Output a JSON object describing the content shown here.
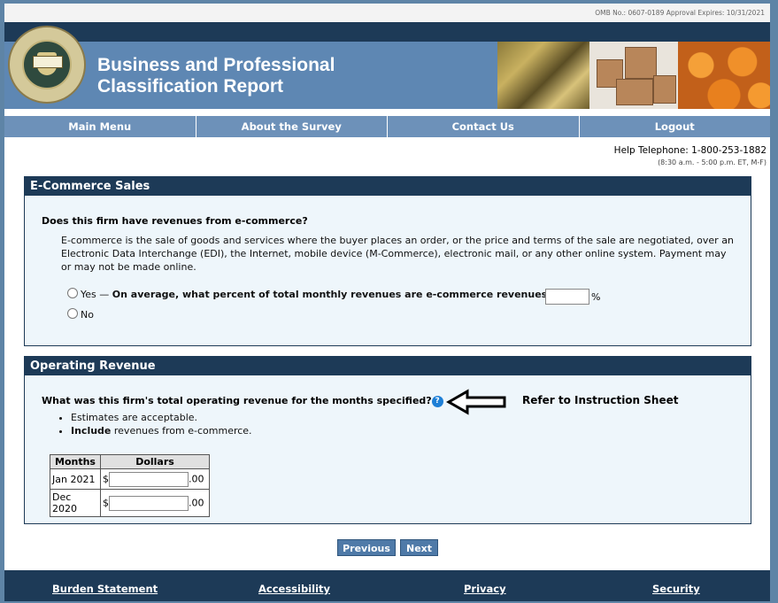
{
  "omb_notice": "OMB No.: 0607-0189 Approval Expires: 10/31/2021",
  "header": {
    "title_line1": "Business and Professional",
    "title_line2": "Classification Report"
  },
  "nav": [
    "Main Menu",
    "About the Survey",
    "Contact Us",
    "Logout"
  ],
  "help": {
    "phone": "Help Telephone: 1-800-253-1882",
    "hours": "(8:30 a.m. - 5:00 p.m. ET, M-F)"
  },
  "ecommerce": {
    "heading": "E-Commerce Sales",
    "question": "Does this firm have revenues from e-commerce?",
    "definition": "E-commerce is the sale of goods and services where the buyer places an order, or the price and terms of the sale are negotiated, over an Electronic Data Interchange (EDI), the Internet, mobile device (M-Commerce), electronic mail, or any other online system. Payment may or may not be made online.",
    "yes_label": "Yes —",
    "yes_question": "On average, what percent of total monthly revenues are e-commerce revenues?",
    "percent_sign": "%",
    "percent_value": "",
    "no_label": "No"
  },
  "revenue": {
    "heading": "Operating Revenue",
    "question": "What was this firm's total operating revenue for the months specified?",
    "help_icon": "question-icon",
    "annotation": "Refer to Instruction Sheet",
    "bullet1": "Estimates are acceptable.",
    "bullet2_bold": "Include",
    "bullet2_rest": " revenues from e-commerce.",
    "table": {
      "col_months": "Months",
      "col_dollars": "Dollars",
      "currency": "$",
      "cents": ".00",
      "rows": [
        {
          "month": "Jan 2021",
          "value": ""
        },
        {
          "month": "Dec 2020",
          "value": ""
        }
      ]
    }
  },
  "buttons": {
    "previous": "Previous",
    "next": "Next"
  },
  "footer": [
    "Burden Statement",
    "Accessibility",
    "Privacy",
    "Security"
  ],
  "colors": {
    "navy": "#1d3a57",
    "banner": "#5e87b3",
    "nav": "#6d91b9",
    "help_icon": "#1e7fd6"
  }
}
